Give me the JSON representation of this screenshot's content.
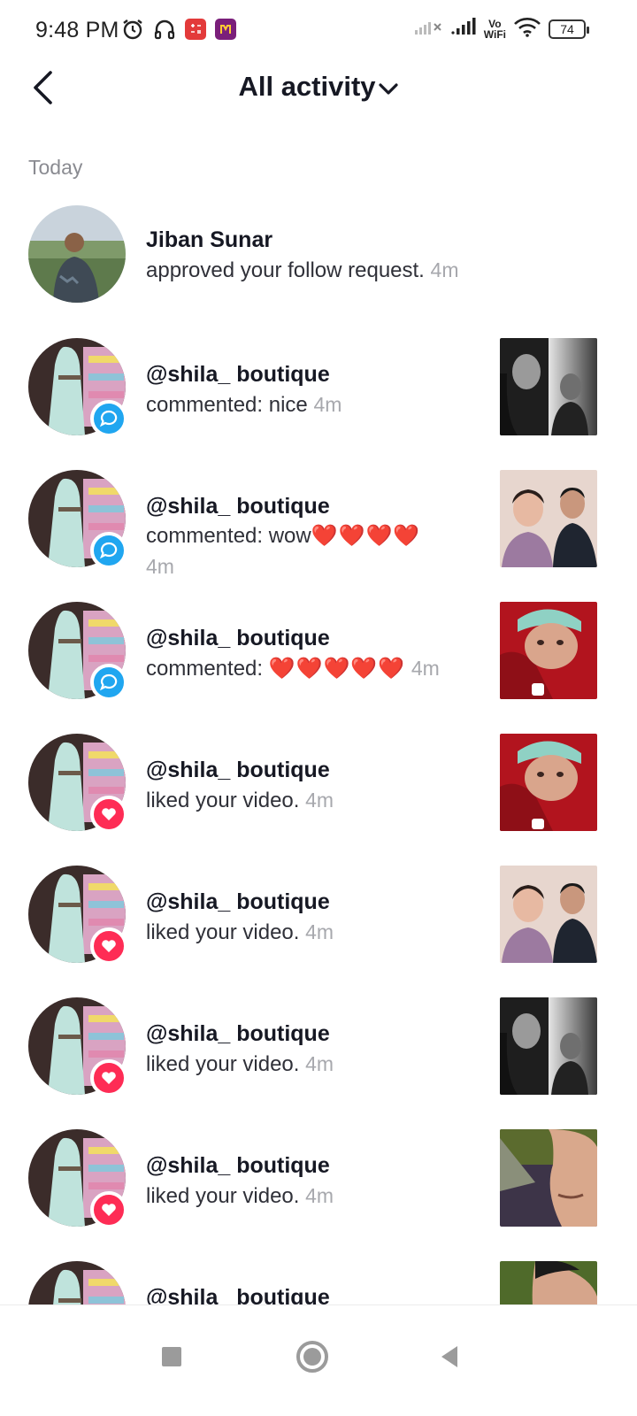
{
  "status_bar": {
    "time": "9:48 PM",
    "battery": "74",
    "vowifi_top": "Vo",
    "vowifi_bottom": "WiFi",
    "icons": [
      "alarm-icon",
      "headphones-icon",
      "calculator-app-icon",
      "m-app-icon",
      "signal-icon",
      "signal-icon",
      "wifi-icon",
      "battery-icon"
    ]
  },
  "header": {
    "title": "All activity",
    "back_icon": "chevron-left-icon",
    "dropdown_icon": "chevron-down-icon"
  },
  "section": {
    "label": "Today"
  },
  "activities": [
    {
      "username": "Jiban Sunar",
      "action": "approved your follow request.",
      "time": "4m",
      "badge": "none",
      "thumb": "none"
    },
    {
      "username": "@shila_ boutique",
      "action": "commented: nice",
      "time": "4m",
      "badge": "comment",
      "thumb": "bw-couple"
    },
    {
      "username": "@shila_ boutique",
      "action": "commented: wow",
      "hearts": "❤️❤️❤️❤️",
      "time": "4m",
      "badge": "comment",
      "thumb": "couple"
    },
    {
      "username": "@shila_ boutique",
      "action": "commented:",
      "hearts": "❤️❤️❤️❤️❤️",
      "time": "4m",
      "badge": "comment",
      "thumb": "baby"
    },
    {
      "username": "@shila_ boutique",
      "action": "liked your video.",
      "time": "4m",
      "badge": "like",
      "thumb": "baby"
    },
    {
      "username": "@shila_ boutique",
      "action": "liked your video.",
      "time": "4m",
      "badge": "like",
      "thumb": "couple"
    },
    {
      "username": "@shila_ boutique",
      "action": "liked your video.",
      "time": "4m",
      "badge": "like",
      "thumb": "bw-couple"
    },
    {
      "username": "@shila_ boutique",
      "action": "liked your video.",
      "time": "4m",
      "badge": "like",
      "thumb": "face"
    },
    {
      "username": "@shila_ boutique",
      "action": "",
      "time": "",
      "badge": "none",
      "thumb": "face-green"
    }
  ],
  "nav_bar": {
    "icons": [
      "recents-square-icon",
      "home-circle-icon",
      "back-triangle-icon"
    ]
  },
  "colors": {
    "comment_badge": "#20a6f0",
    "like_badge": "#fe2c55",
    "time_text": "#a7a8ad"
  }
}
